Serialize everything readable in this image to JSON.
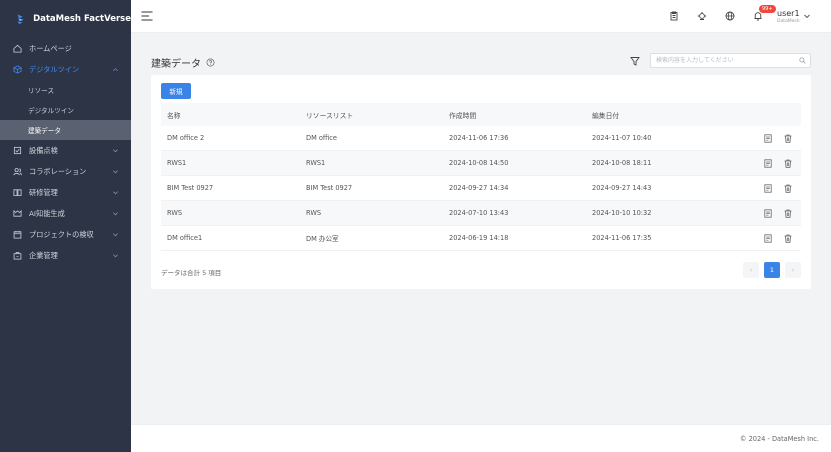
{
  "app": {
    "name": "DataMesh FactVerse"
  },
  "sidebar": {
    "items": [
      {
        "label": "ホームページ",
        "icon": "home-icon"
      },
      {
        "label": "デジタルツイン",
        "icon": "cube-icon",
        "expanded": true,
        "children": [
          {
            "label": "リソース"
          },
          {
            "label": "デジタルツイン"
          },
          {
            "label": "建築データ",
            "active": true
          }
        ]
      },
      {
        "label": "設備点検",
        "icon": "checkbox-icon"
      },
      {
        "label": "コラボレーション",
        "icon": "users-icon"
      },
      {
        "label": "研修管理",
        "icon": "book-icon"
      },
      {
        "label": "AI知能生成",
        "icon": "ai-icon"
      },
      {
        "label": "プロジェクトの検収",
        "icon": "calendar-icon"
      },
      {
        "label": "企業管理",
        "icon": "building-icon"
      }
    ]
  },
  "header": {
    "notification_badge": "99+",
    "user_name": "user1",
    "user_org": "DataMesh"
  },
  "main": {
    "title": "建築データ",
    "search_placeholder": "検索内容を入力してください",
    "new_button": "新規",
    "columns": [
      "名称",
      "リソースリスト",
      "作成時間",
      "編集日付"
    ],
    "rows": [
      {
        "name": "DM office 2",
        "resource": "DM office",
        "created": "2024-11-06 17:36",
        "edited": "2024-11-07 10:40"
      },
      {
        "name": "RWS1",
        "resource": "RWS1",
        "created": "2024-10-08 14:50",
        "edited": "2024-10-08 18:11"
      },
      {
        "name": "BIM Test 0927",
        "resource": "BIM Test 0927",
        "created": "2024-09-27 14:34",
        "edited": "2024-09-27 14:43"
      },
      {
        "name": "RWS",
        "resource": "RWS",
        "created": "2024-07-10 13:43",
        "edited": "2024-10-10 10:32"
      },
      {
        "name": "DM office1",
        "resource": "DM 办公室",
        "created": "2024-06-19 14:18",
        "edited": "2024-11-06 17:35"
      }
    ],
    "total_text": "データは合計 5 項目",
    "pagination": {
      "prev": "‹",
      "current": "1",
      "next": "›"
    }
  },
  "footer": {
    "copyright": "© 2024 - DataMesh Inc."
  },
  "colors": {
    "sidebar_bg": "#2d3446",
    "accent": "#3a84e8",
    "badge": "#f0483e"
  }
}
